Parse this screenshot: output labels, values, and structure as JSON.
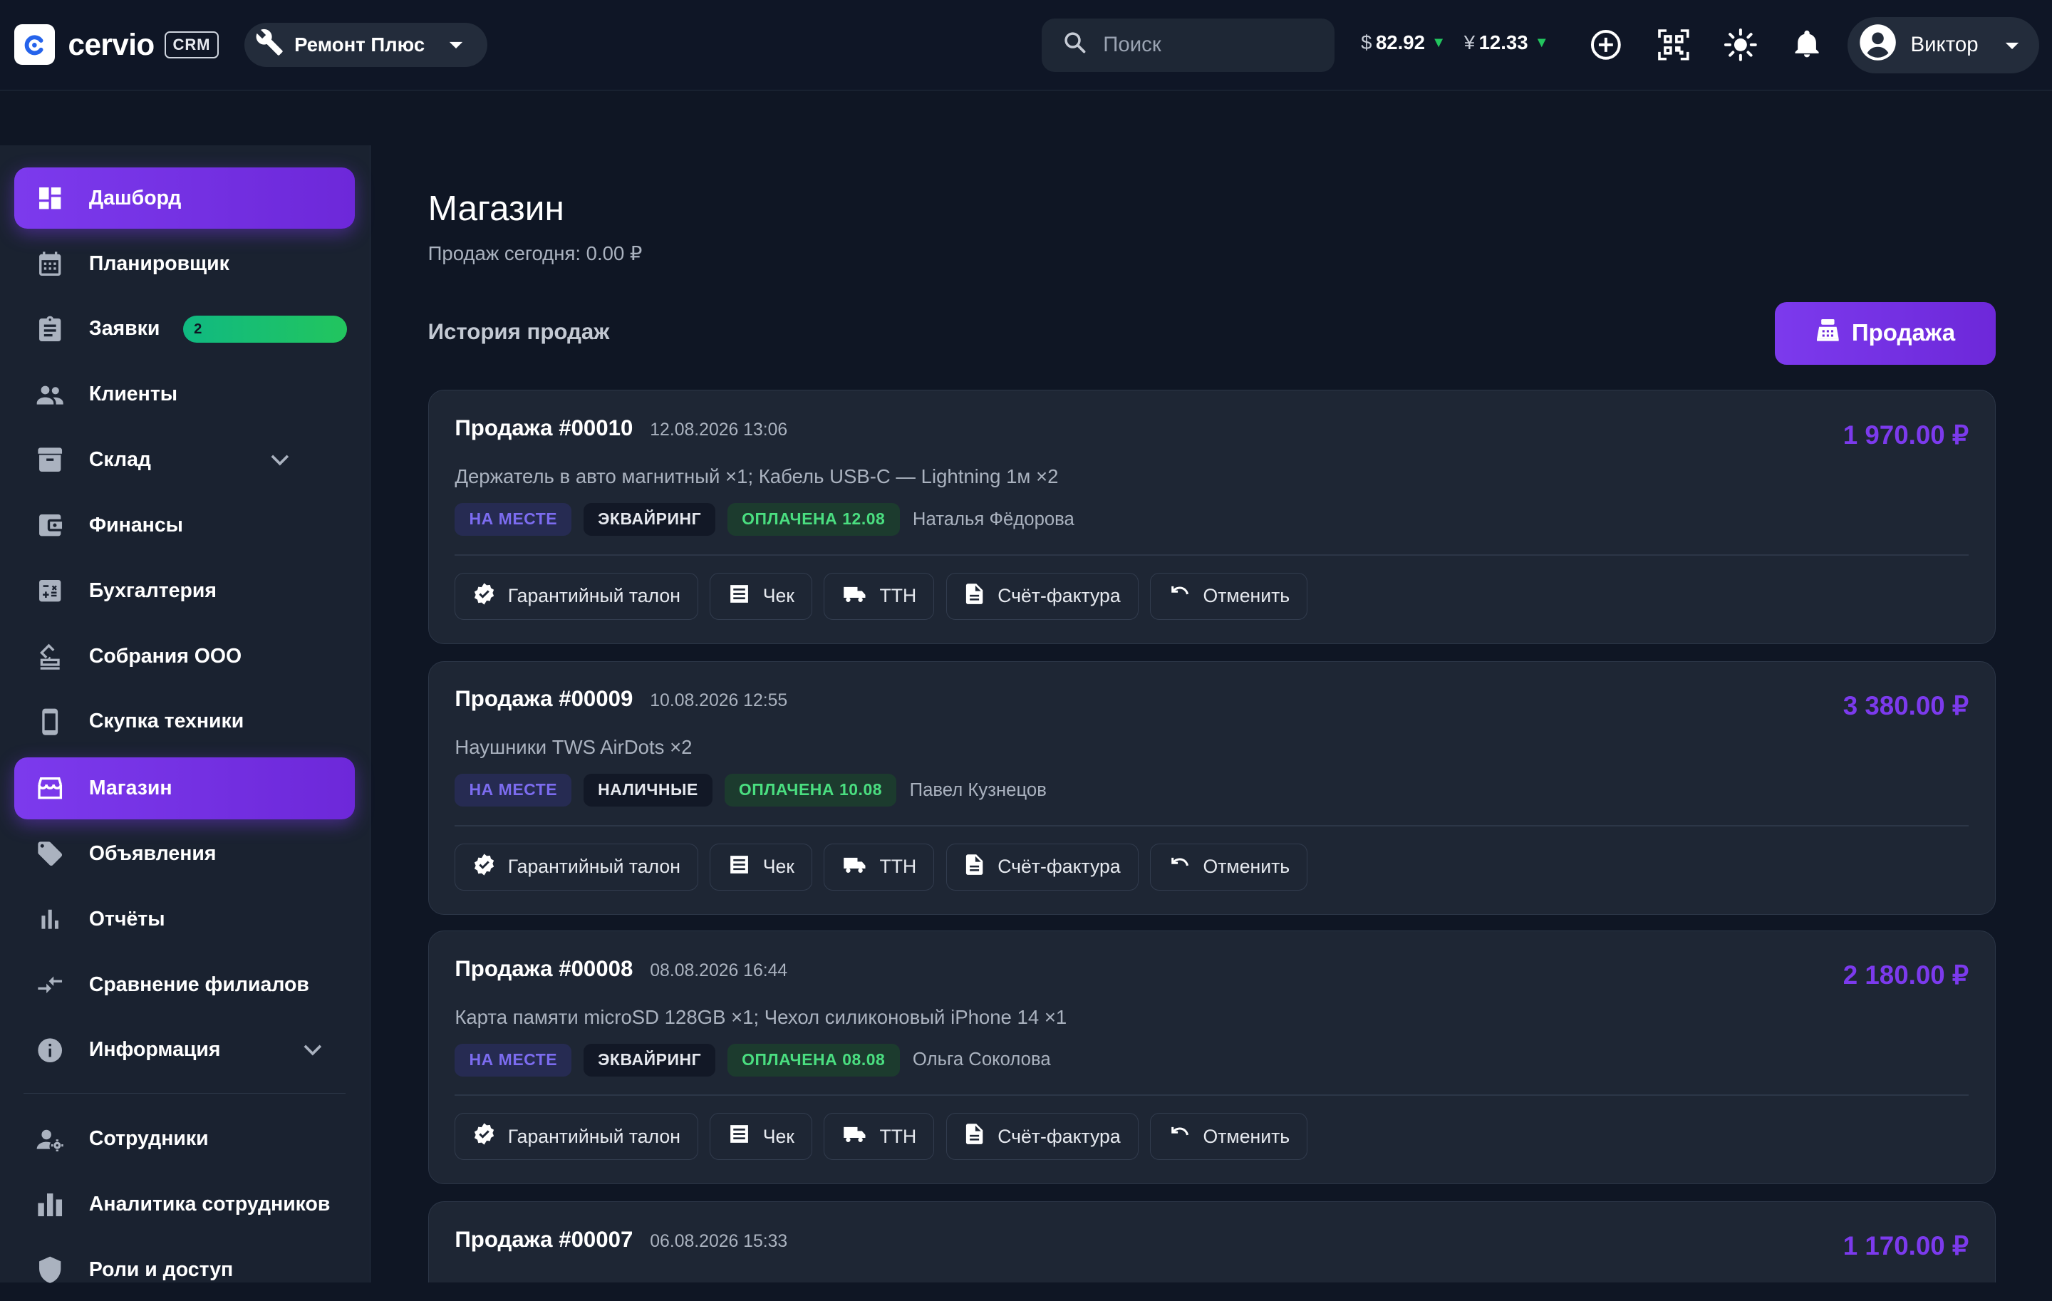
{
  "app": {
    "name": "cervio",
    "badge": "CRM",
    "org": "Ремонт Плюс"
  },
  "search": {
    "placeholder": "Поиск"
  },
  "rates": [
    {
      "symbol": "$",
      "value": "82.92"
    },
    {
      "symbol": "¥",
      "value": "12.33"
    }
  ],
  "user": {
    "name": "Виктор"
  },
  "sidebar": {
    "items": [
      {
        "label": "Дашборд",
        "icon": "dashboard-icon",
        "active": true
      },
      {
        "label": "Планировщик",
        "icon": "calendar-icon"
      },
      {
        "label": "Заявки",
        "icon": "clipboard-icon",
        "badge": "2"
      },
      {
        "label": "Клиенты",
        "icon": "people-icon"
      },
      {
        "label": "Склад",
        "icon": "archive-icon",
        "expandable": true
      },
      {
        "label": "Финансы",
        "icon": "wallet-icon"
      },
      {
        "label": "Бухгалтерия",
        "icon": "calculator-icon"
      },
      {
        "label": "Собрания ООО",
        "icon": "stamp-icon"
      },
      {
        "label": "Скупка техники",
        "icon": "phone-icon"
      },
      {
        "label": "Магазин",
        "icon": "store-icon",
        "active": true
      },
      {
        "label": "Объявления",
        "icon": "tag-icon"
      },
      {
        "label": "Отчёты",
        "icon": "bar-chart-icon"
      },
      {
        "label": "Сравнение филиалов",
        "icon": "compare-arrows-icon"
      },
      {
        "label": "Информация",
        "icon": "info-icon",
        "expandable": true
      },
      {
        "label": "Сотрудники",
        "icon": "staff-icon"
      },
      {
        "label": "Аналитика сотрудников",
        "icon": "analytics-icon"
      },
      {
        "label": "Роли и доступ",
        "icon": "shield-icon"
      }
    ]
  },
  "page": {
    "title": "Магазин",
    "subtitle": "Продаж сегодня: 0.00 ₽",
    "section": "История продаж",
    "sale_button": "Продажа"
  },
  "actions": {
    "warranty": "Гарантийный талон",
    "receipt": "Чек",
    "waybill": "ТТН",
    "invoice": "Счёт-фактура",
    "cancel": "Отменить"
  },
  "sales": [
    {
      "title": "Продажа #00010",
      "date": "12.08.2026 13:06",
      "amount": "1 970.00 ₽",
      "items": "Держатель в авто магнитный ×1; Кабель USB-C — Lightning 1м ×2",
      "place": "НА МЕСТЕ",
      "payment": "ЭКВАЙРИНГ",
      "status": "ОПЛАЧЕНА 12.08",
      "client": "Наталья Фёдорова"
    },
    {
      "title": "Продажа #00009",
      "date": "10.08.2026 12:55",
      "amount": "3 380.00 ₽",
      "items": "Наушники TWS AirDots ×2",
      "place": "НА МЕСТЕ",
      "payment": "НАЛИЧНЫЕ",
      "status": "ОПЛАЧЕНА 10.08",
      "client": "Павел Кузнецов"
    },
    {
      "title": "Продажа #00008",
      "date": "08.08.2026 16:44",
      "amount": "2 180.00 ₽",
      "items": "Карта памяти microSD 128GB ×1; Чехол силиконовый iPhone 14 ×1",
      "place": "НА МЕСТЕ",
      "payment": "ЭКВАЙРИНГ",
      "status": "ОПЛАЧЕНА 08.08",
      "client": "Ольга Соколова"
    },
    {
      "title": "Продажа #00007",
      "date": "06.08.2026 15:33",
      "amount": "1 170.00 ₽"
    }
  ],
  "colors": {
    "accent": "#7c3aed",
    "success": "#22c55e",
    "background": "#0f1624"
  }
}
